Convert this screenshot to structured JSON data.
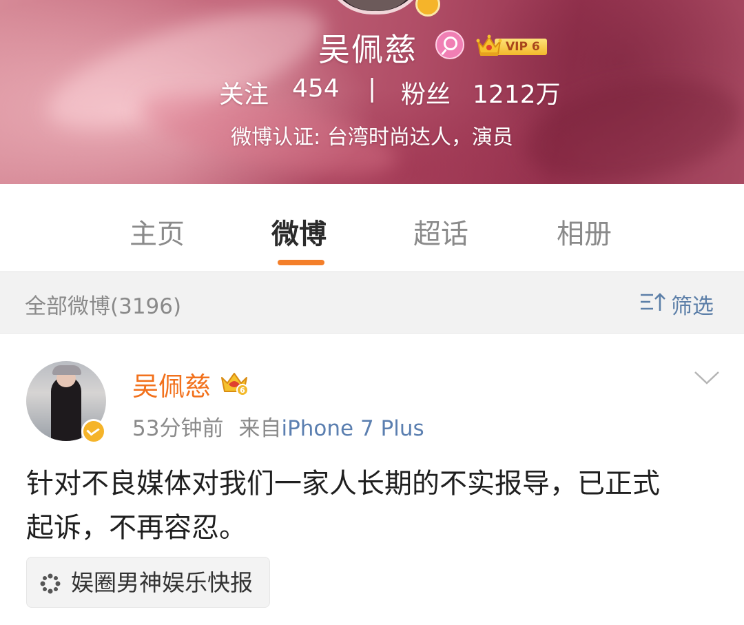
{
  "profile": {
    "name": "吴佩慈",
    "vip_level": "VIP 6",
    "follow_label": "关注",
    "follow_count": "454",
    "separator": "|",
    "fans_label": "粉丝",
    "fans_count": "1212万",
    "verification": "微博认证: 台湾时尚达人，演员"
  },
  "tabs": [
    {
      "label": "主页",
      "active": false
    },
    {
      "label": "微博",
      "active": true
    },
    {
      "label": "超话",
      "active": false
    },
    {
      "label": "相册",
      "active": false
    }
  ],
  "filter_bar": {
    "title": "全部微博(3196)",
    "filter_label": "筛选"
  },
  "post": {
    "author": "吴佩慈",
    "time": "53分钟前",
    "source_prefix": "来自",
    "source_name": "iPhone 7 Plus",
    "text_lines": [
      "针对不良媒体对我们一家人长期的不实报导，已正式",
      "起诉，不再容忍。"
    ],
    "tag": "娱圈男神娱乐快报"
  },
  "colors": {
    "accent_orange": "#f47f2a",
    "author_orange": "#f2711c",
    "link_blue": "#5b7fb0",
    "filter_blue": "#5c7fa8",
    "vip_gold": "#f3b92b",
    "female_pink": "#f07fb4"
  },
  "icons": {
    "gender": "female-icon",
    "vip": "crown-icon",
    "filter": "filter-sort-icon",
    "post_menu": "chevron-down-icon",
    "tag": "super-topic-icon"
  }
}
